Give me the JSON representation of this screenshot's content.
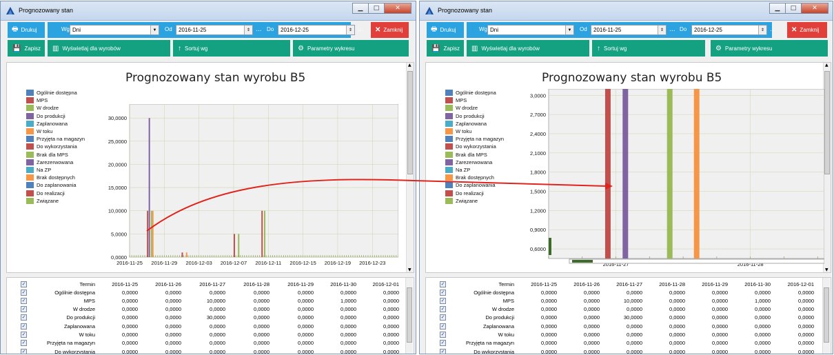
{
  "window": {
    "title": "Prognozowany stan"
  },
  "toolbar": {
    "print_label": "Drukuj",
    "wg_label": "Wg",
    "wg_value": "Dni",
    "od_label": "Od",
    "od_value": "2016-11-25",
    "do_label": "Do",
    "do_value": "2016-12-25",
    "ellipsis": "...",
    "close_label": "Zamknij",
    "save_label": "Zapisz",
    "show_products_label": "Wyświetlaj dla wyrobów",
    "sort_label": "Sortuj wg",
    "chart_params_label": "Parametry wykresu"
  },
  "chart": {
    "title": "Prognozowany stan wyrobu B5",
    "legend": [
      {
        "label": "Ogólnie dostępna",
        "color": "#4f81bd"
      },
      {
        "label": "MPS",
        "color": "#c0504d"
      },
      {
        "label": "W drodze",
        "color": "#9bbb59"
      },
      {
        "label": "Do produkcji",
        "color": "#8064a2"
      },
      {
        "label": "Zaplanowana",
        "color": "#4bacc6"
      },
      {
        "label": "W toku",
        "color": "#f79646"
      },
      {
        "label": "Przyjęta na magazyn",
        "color": "#4f81bd"
      },
      {
        "label": "Do wykorzystania",
        "color": "#c0504d"
      },
      {
        "label": "Brak dla MPS",
        "color": "#9bbb59"
      },
      {
        "label": "Zarezerwowana",
        "color": "#8064a2"
      },
      {
        "label": "Na ZP",
        "color": "#4bacc6"
      },
      {
        "label": "Brak dostępnych",
        "color": "#f79646"
      },
      {
        "label": "Do zaplanowania",
        "color": "#4f81bd"
      },
      {
        "label": "Do realizacji",
        "color": "#c0504d"
      },
      {
        "label": "Związane",
        "color": "#9bbb59"
      }
    ]
  },
  "chart_data": [
    {
      "type": "bar",
      "title": "Prognozowany stan wyrobu B5",
      "ylim": [
        0,
        33
      ],
      "yticks": [
        "0,0000",
        "5,0000",
        "10,0000",
        "15,0000",
        "20,0000",
        "25,0000",
        "30,0000"
      ],
      "ytick_values": [
        0,
        5,
        10,
        15,
        20,
        25,
        30
      ],
      "xticks": [
        "2016-11-25",
        "2016-11-29",
        "2016-12-03",
        "2016-12-07",
        "2016-12-11",
        "2016-12-15",
        "2016-12-19",
        "2016-12-23"
      ],
      "xtick_days": [
        0,
        4,
        8,
        12,
        16,
        20,
        24,
        28
      ],
      "xlim_days": [
        0,
        31
      ],
      "grid": true,
      "bars": [
        {
          "day": 2.0,
          "value": 10,
          "color": "#c0504d"
        },
        {
          "day": 2.2,
          "value": 30,
          "color": "#8064a2"
        },
        {
          "day": 2.45,
          "value": 10,
          "color": "#9bbb59"
        },
        {
          "day": 2.6,
          "value": 10,
          "color": "#f79646"
        },
        {
          "day": 6.0,
          "value": 1,
          "color": "#c0504d"
        },
        {
          "day": 6.5,
          "value": 1,
          "color": "#f79646"
        },
        {
          "day": 12.0,
          "value": 5,
          "color": "#c0504d"
        },
        {
          "day": 12.5,
          "value": 5,
          "color": "#9bbb59"
        },
        {
          "day": 15.2,
          "value": 10,
          "color": "#c0504d"
        },
        {
          "day": 15.5,
          "value": 10,
          "color": "#9bbb59"
        }
      ]
    },
    {
      "type": "bar",
      "title": "Prognozowany stan wyrobu B5",
      "ylim": [
        0.45,
        3.1
      ],
      "yticks": [
        "0,6000",
        "0,9000",
        "1,2000",
        "1,5000",
        "1,8000",
        "2,1000",
        "2,4000",
        "2,7000",
        "3,0000"
      ],
      "ytick_values": [
        0.6,
        0.9,
        1.2,
        1.5,
        1.8,
        2.1,
        2.4,
        2.7,
        3.0
      ],
      "xticks": [
        "2016-11-27",
        "2016-11-28"
      ],
      "xtick_days": [
        2,
        3
      ],
      "xlim_days": [
        1.5,
        3.55
      ],
      "grid": true,
      "bars": [
        {
          "day": 1.92,
          "value": 3.1,
          "color": "#c0504d"
        },
        {
          "day": 2.05,
          "value": 3.1,
          "color": "#8064a2"
        },
        {
          "day": 2.38,
          "value": 3.1,
          "color": "#9bbb59"
        },
        {
          "day": 2.58,
          "value": 3.1,
          "color": "#f79646"
        }
      ]
    }
  ],
  "table": {
    "columns": [
      "Termin",
      "2016-11-25",
      "2016-11-26",
      "2016-11-27",
      "2016-11-28",
      "2016-11-29",
      "2016-11-30",
      "2016-12-01"
    ],
    "rows": [
      {
        "name": "Ogólnie dostępna",
        "values": [
          "0,0000",
          "0,0000",
          "0,0000",
          "0,0000",
          "0,0000",
          "0,0000",
          "0,0000"
        ]
      },
      {
        "name": "MPS",
        "values": [
          "0,0000",
          "0,0000",
          "10,0000",
          "0,0000",
          "0,0000",
          "1,0000",
          "0,0000"
        ]
      },
      {
        "name": "W drodze",
        "values": [
          "0,0000",
          "0,0000",
          "0,0000",
          "0,0000",
          "0,0000",
          "0,0000",
          "0,0000"
        ]
      },
      {
        "name": "Do produkcji",
        "values": [
          "0,0000",
          "0,0000",
          "30,0000",
          "0,0000",
          "0,0000",
          "0,0000",
          "0,0000"
        ]
      },
      {
        "name": "Zaplanowana",
        "values": [
          "0,0000",
          "0,0000",
          "0,0000",
          "0,0000",
          "0,0000",
          "0,0000",
          "0,0000"
        ]
      },
      {
        "name": "W toku",
        "values": [
          "0,0000",
          "0,0000",
          "0,0000",
          "0,0000",
          "0,0000",
          "0,0000",
          "0,0000"
        ]
      },
      {
        "name": "Przyjęta na magazyn",
        "values": [
          "0,0000",
          "0,0000",
          "0,0000",
          "0,0000",
          "0,0000",
          "0,0000",
          "0,0000"
        ]
      },
      {
        "name": "Do wykorzystania",
        "values": [
          "0,0000",
          "0,0000",
          "0,0000",
          "0,0000",
          "0,0000",
          "0,0000",
          "0,0000"
        ]
      }
    ]
  },
  "annotation": {
    "color": "#e0241b"
  }
}
